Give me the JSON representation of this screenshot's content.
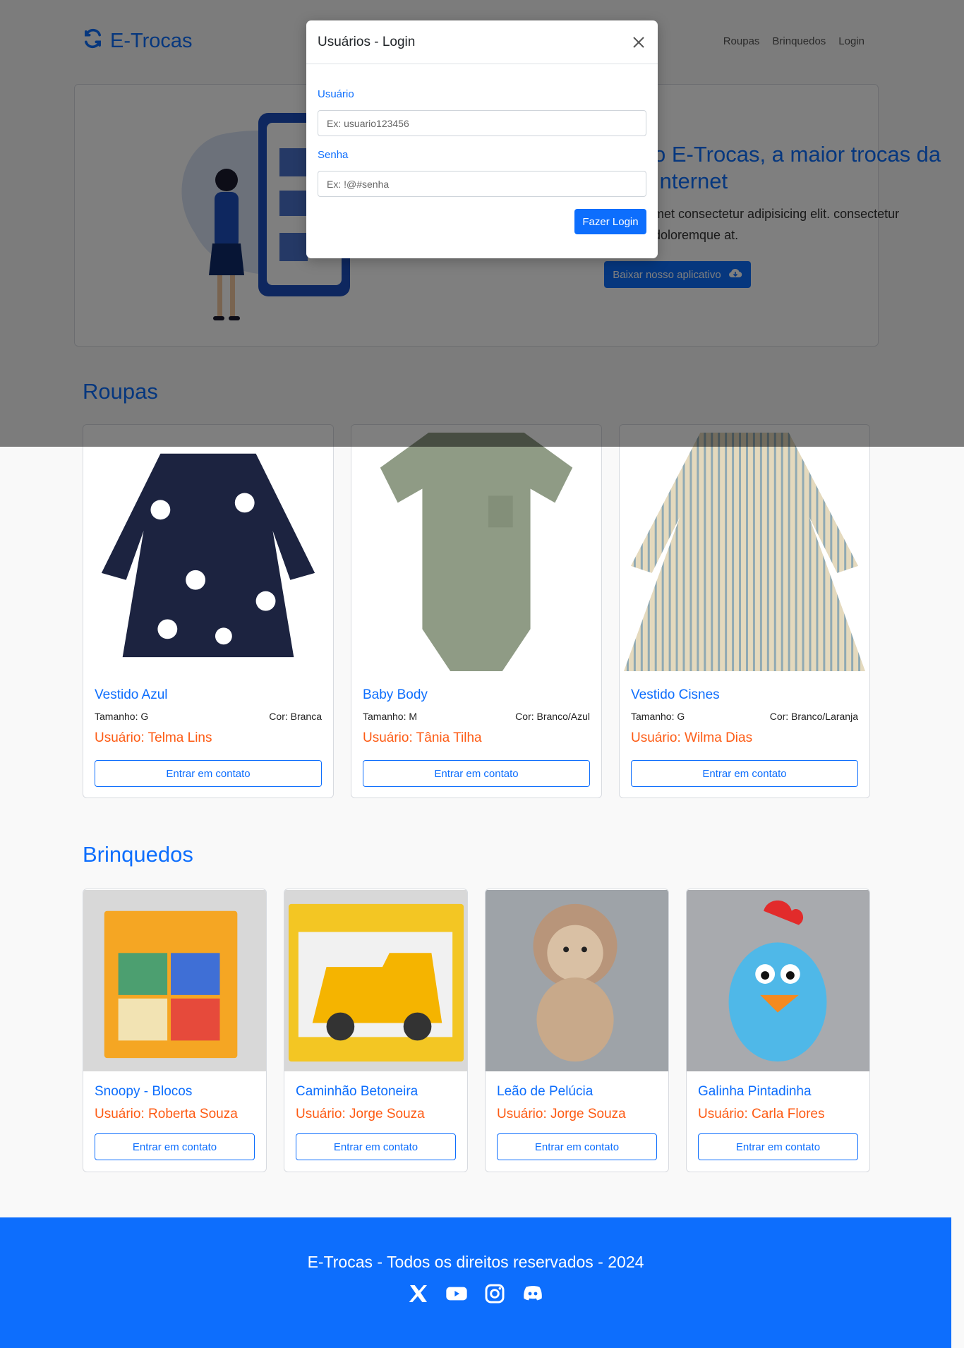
{
  "brand": {
    "name": "E-Trocas",
    "icon": "refresh-icon"
  },
  "nav": {
    "items": [
      "Roupas",
      "Brinquedos",
      "Login"
    ]
  },
  "hero": {
    "title": "o E-Trocas, a maior trocas da Internet",
    "text": "met consectetur adipisicing elit. consectetur doloremque at.",
    "button_label": "Baixar nosso aplicativo",
    "button_icon": "cloud-download-icon"
  },
  "clothes": {
    "title": "Roupas",
    "items": [
      {
        "name": "Vestido Azul",
        "size": "Tamanho: G",
        "color": "Cor: Branca",
        "user": "Usuário: Telma Lins",
        "button": "Entrar em contato"
      },
      {
        "name": "Baby Body",
        "size": "Tamanho: M",
        "color": "Cor: Branco/Azul",
        "user": "Usuário: Tânia Tilha",
        "button": "Entrar em contato"
      },
      {
        "name": "Vestido Cisnes",
        "size": "Tamanho: G",
        "color": "Cor: Branco/Laranja",
        "user": "Usuário: Wilma Dias",
        "button": "Entrar em contato"
      }
    ]
  },
  "toys": {
    "title": "Brinquedos",
    "items": [
      {
        "name": "Snoopy - Blocos",
        "user": "Usuário: Roberta Souza",
        "button": "Entrar em contato"
      },
      {
        "name": "Caminhão Betoneira",
        "user": "Usuário: Jorge Souza",
        "button": "Entrar em contato"
      },
      {
        "name": "Leão de Pelúcia",
        "user": "Usuário: Jorge Souza",
        "button": "Entrar em contato"
      },
      {
        "name": "Galinha Pintadinha",
        "user": "Usuário: Carla Flores",
        "button": "Entrar em contato"
      }
    ]
  },
  "footer": {
    "text": "E-Trocas - Todos os direitos reservados - 2024",
    "socials": [
      "x-icon",
      "youtube-icon",
      "instagram-icon",
      "discord-icon"
    ]
  },
  "modal": {
    "title": "Usuários - Login",
    "user_label": "Usuário",
    "user_placeholder": "Ex: usuario123456",
    "password_label": "Senha",
    "password_placeholder": "Ex: !@#senha",
    "submit_label": "Fazer Login"
  },
  "colors": {
    "primary": "#0d6efd",
    "accent": "#fd5b14",
    "backdrop": "rgba(0,0,0,0.5)"
  }
}
